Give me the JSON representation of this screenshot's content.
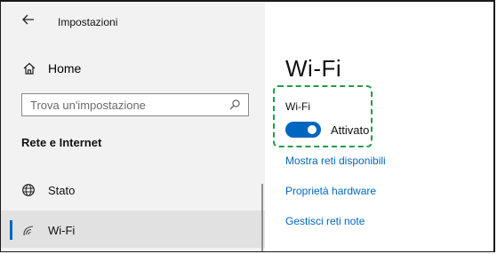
{
  "window": {
    "title": "Impostazioni",
    "back_icon": "back-arrow-icon"
  },
  "sidebar": {
    "home": {
      "label": "Home",
      "icon": "home-icon"
    },
    "search": {
      "placeholder": "Trova un'impostazione",
      "value": "",
      "icon": "search-icon"
    },
    "section_heading": "Rete e Internet",
    "items": [
      {
        "label": "Stato",
        "icon": "globe-icon",
        "selected": false
      },
      {
        "label": "Wi-Fi",
        "icon": "wifi-icon",
        "selected": true
      }
    ]
  },
  "main": {
    "title": "Wi-Fi",
    "wifi_toggle": {
      "label": "Wi-Fi",
      "state_label": "Attivato",
      "on": true
    },
    "links": [
      {
        "label": "Mostra reti disponibili"
      },
      {
        "label": "Proprietà hardware"
      },
      {
        "label": "Gestisci reti note"
      }
    ]
  },
  "colors": {
    "accent": "#0067c0",
    "highlight": "#1e9e4a",
    "sidebar_bg": "#f2f2f2",
    "selected_bg": "#e1e1e1"
  }
}
